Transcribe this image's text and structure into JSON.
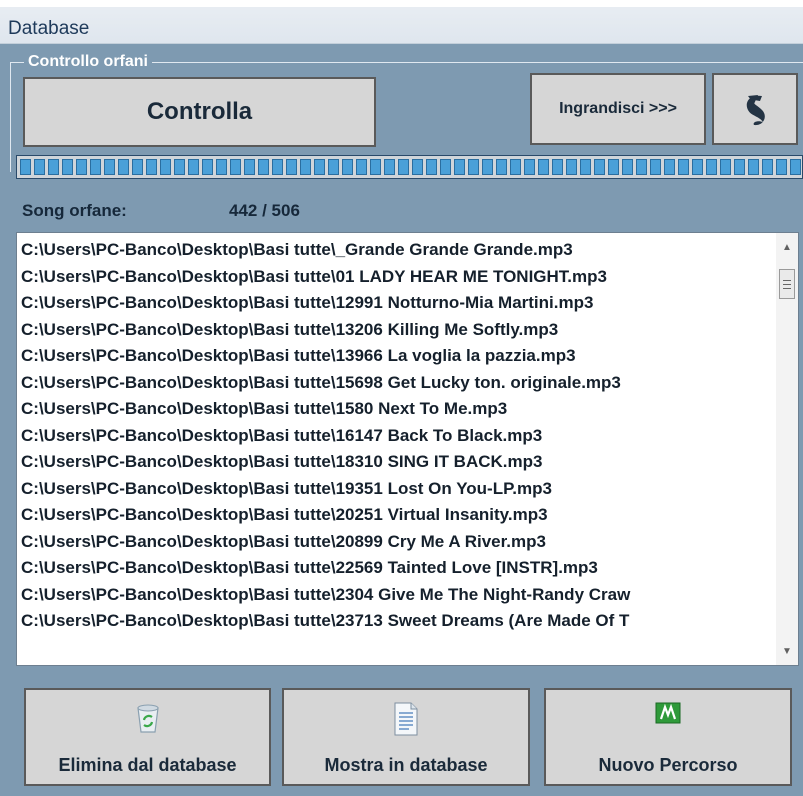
{
  "window": {
    "title": "Database"
  },
  "groupbox": {
    "legend": "Controllo orfani"
  },
  "buttons": {
    "controlla": "Controlla",
    "ingrandisci": "Ingrandisci >>>",
    "elimina": "Elimina dal database",
    "mostra": "Mostra in database",
    "nuovo": "Nuovo Percorso"
  },
  "icons": {
    "undo": "undo-arrow-icon",
    "recycle": "recycle-bin-icon",
    "document": "document-icon",
    "folder_path": "green-path-icon"
  },
  "progress": {
    "fraction": 1.0
  },
  "stats": {
    "label": "Song orfane:",
    "count": "442 / 506"
  },
  "list": {
    "items": [
      "C:\\Users\\PC-Banco\\Desktop\\Basi tutte\\_Grande Grande Grande.mp3",
      "C:\\Users\\PC-Banco\\Desktop\\Basi tutte\\01 LADY HEAR ME TONIGHT.mp3",
      "C:\\Users\\PC-Banco\\Desktop\\Basi tutte\\12991 Notturno-Mia Martini.mp3",
      "C:\\Users\\PC-Banco\\Desktop\\Basi tutte\\13206 Killing Me Softly.mp3",
      "C:\\Users\\PC-Banco\\Desktop\\Basi tutte\\13966 La voglia la pazzia.mp3",
      "C:\\Users\\PC-Banco\\Desktop\\Basi tutte\\15698 Get Lucky ton. originale.mp3",
      "C:\\Users\\PC-Banco\\Desktop\\Basi tutte\\1580 Next To Me.mp3",
      "C:\\Users\\PC-Banco\\Desktop\\Basi tutte\\16147 Back To Black.mp3",
      "C:\\Users\\PC-Banco\\Desktop\\Basi tutte\\18310 SING IT BACK.mp3",
      "C:\\Users\\PC-Banco\\Desktop\\Basi tutte\\19351 Lost On You-LP.mp3",
      "C:\\Users\\PC-Banco\\Desktop\\Basi tutte\\20251 Virtual Insanity.mp3",
      "C:\\Users\\PC-Banco\\Desktop\\Basi tutte\\20899 Cry Me A River.mp3",
      "C:\\Users\\PC-Banco\\Desktop\\Basi tutte\\22569 Tainted Love [INSTR].mp3",
      "C:\\Users\\PC-Banco\\Desktop\\Basi tutte\\2304 Give Me The Night-Randy Craw",
      "C:\\Users\\PC-Banco\\Desktop\\Basi tutte\\23713 Sweet Dreams (Are Made Of T"
    ]
  },
  "colors": {
    "panel": "#7e9ab1",
    "button_face": "#d6d6d6",
    "progress_segment": "#4aa0d8"
  }
}
